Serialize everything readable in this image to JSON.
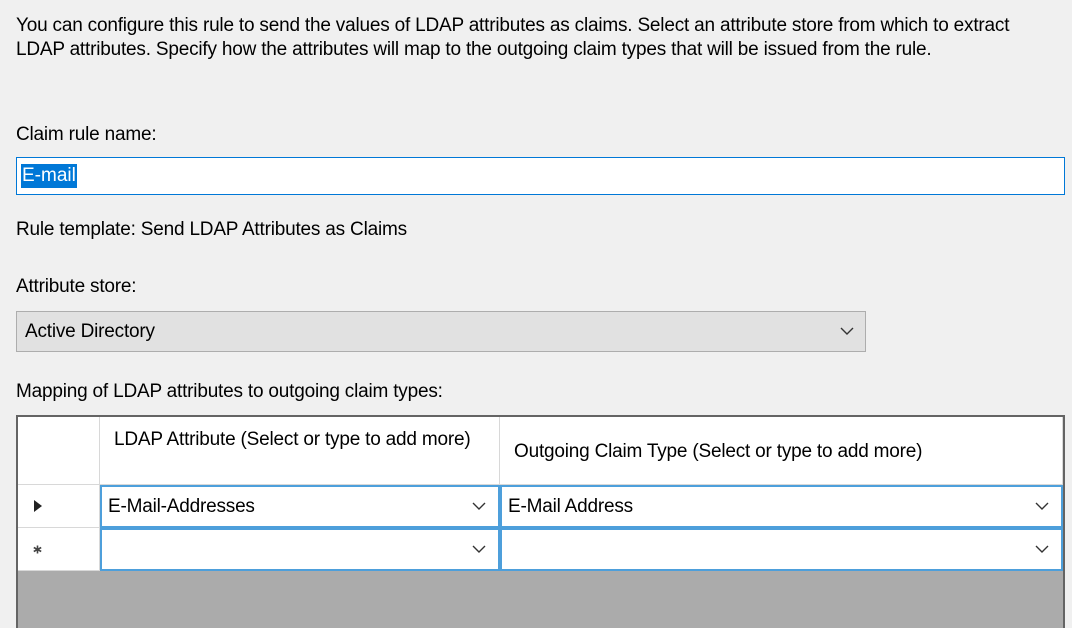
{
  "description": "You can configure this rule to send the values of LDAP attributes as claims. Select an attribute store from which to extract LDAP attributes. Specify how the attributes will map to the outgoing claim types that will be issued from the rule.",
  "rule_name": {
    "label": "Claim rule name:",
    "value": "E-mail"
  },
  "rule_template": "Rule template: Send LDAP Attributes as Claims",
  "attribute_store": {
    "label": "Attribute store:",
    "selected": "Active Directory"
  },
  "mapping": {
    "label": "Mapping of LDAP attributes to outgoing claim types:",
    "columns": [
      "LDAP Attribute (Select or type to add more)",
      "Outgoing Claim Type (Select or type to add more)"
    ],
    "rows": [
      {
        "ldap": "E-Mail-Addresses",
        "claim": "E-Mail Address"
      },
      {
        "ldap": "",
        "claim": ""
      }
    ]
  },
  "icons": {
    "row_current": "triangle-right-icon",
    "row_new": "asterisk-icon",
    "dropdown": "chevron-down-icon"
  },
  "colors": {
    "accent": "#0078d7",
    "window_bg": "#f0f0f0",
    "grid_empty": "#ababab"
  }
}
